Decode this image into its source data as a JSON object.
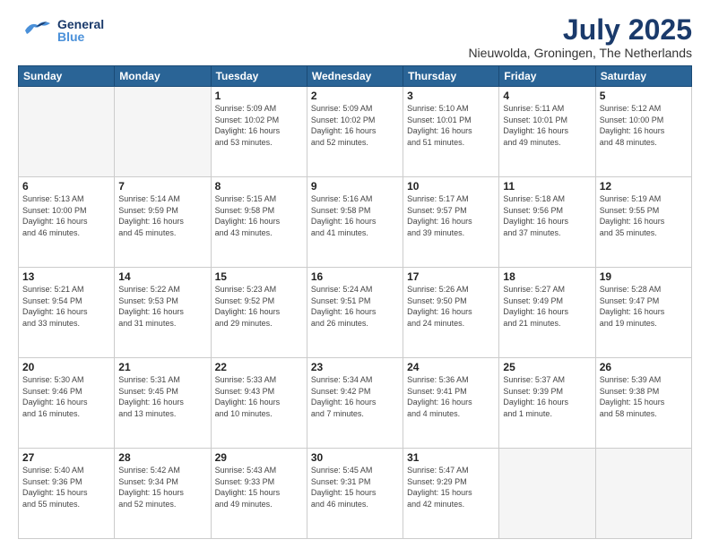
{
  "header": {
    "logo_general": "General",
    "logo_blue": "Blue",
    "month": "July 2025",
    "location": "Nieuwolda, Groningen, The Netherlands"
  },
  "days_of_week": [
    "Sunday",
    "Monday",
    "Tuesday",
    "Wednesday",
    "Thursday",
    "Friday",
    "Saturday"
  ],
  "weeks": [
    [
      {
        "day": "",
        "info": ""
      },
      {
        "day": "",
        "info": ""
      },
      {
        "day": "1",
        "info": "Sunrise: 5:09 AM\nSunset: 10:02 PM\nDaylight: 16 hours\nand 53 minutes."
      },
      {
        "day": "2",
        "info": "Sunrise: 5:09 AM\nSunset: 10:02 PM\nDaylight: 16 hours\nand 52 minutes."
      },
      {
        "day": "3",
        "info": "Sunrise: 5:10 AM\nSunset: 10:01 PM\nDaylight: 16 hours\nand 51 minutes."
      },
      {
        "day": "4",
        "info": "Sunrise: 5:11 AM\nSunset: 10:01 PM\nDaylight: 16 hours\nand 49 minutes."
      },
      {
        "day": "5",
        "info": "Sunrise: 5:12 AM\nSunset: 10:00 PM\nDaylight: 16 hours\nand 48 minutes."
      }
    ],
    [
      {
        "day": "6",
        "info": "Sunrise: 5:13 AM\nSunset: 10:00 PM\nDaylight: 16 hours\nand 46 minutes."
      },
      {
        "day": "7",
        "info": "Sunrise: 5:14 AM\nSunset: 9:59 PM\nDaylight: 16 hours\nand 45 minutes."
      },
      {
        "day": "8",
        "info": "Sunrise: 5:15 AM\nSunset: 9:58 PM\nDaylight: 16 hours\nand 43 minutes."
      },
      {
        "day": "9",
        "info": "Sunrise: 5:16 AM\nSunset: 9:58 PM\nDaylight: 16 hours\nand 41 minutes."
      },
      {
        "day": "10",
        "info": "Sunrise: 5:17 AM\nSunset: 9:57 PM\nDaylight: 16 hours\nand 39 minutes."
      },
      {
        "day": "11",
        "info": "Sunrise: 5:18 AM\nSunset: 9:56 PM\nDaylight: 16 hours\nand 37 minutes."
      },
      {
        "day": "12",
        "info": "Sunrise: 5:19 AM\nSunset: 9:55 PM\nDaylight: 16 hours\nand 35 minutes."
      }
    ],
    [
      {
        "day": "13",
        "info": "Sunrise: 5:21 AM\nSunset: 9:54 PM\nDaylight: 16 hours\nand 33 minutes."
      },
      {
        "day": "14",
        "info": "Sunrise: 5:22 AM\nSunset: 9:53 PM\nDaylight: 16 hours\nand 31 minutes."
      },
      {
        "day": "15",
        "info": "Sunrise: 5:23 AM\nSunset: 9:52 PM\nDaylight: 16 hours\nand 29 minutes."
      },
      {
        "day": "16",
        "info": "Sunrise: 5:24 AM\nSunset: 9:51 PM\nDaylight: 16 hours\nand 26 minutes."
      },
      {
        "day": "17",
        "info": "Sunrise: 5:26 AM\nSunset: 9:50 PM\nDaylight: 16 hours\nand 24 minutes."
      },
      {
        "day": "18",
        "info": "Sunrise: 5:27 AM\nSunset: 9:49 PM\nDaylight: 16 hours\nand 21 minutes."
      },
      {
        "day": "19",
        "info": "Sunrise: 5:28 AM\nSunset: 9:47 PM\nDaylight: 16 hours\nand 19 minutes."
      }
    ],
    [
      {
        "day": "20",
        "info": "Sunrise: 5:30 AM\nSunset: 9:46 PM\nDaylight: 16 hours\nand 16 minutes."
      },
      {
        "day": "21",
        "info": "Sunrise: 5:31 AM\nSunset: 9:45 PM\nDaylight: 16 hours\nand 13 minutes."
      },
      {
        "day": "22",
        "info": "Sunrise: 5:33 AM\nSunset: 9:43 PM\nDaylight: 16 hours\nand 10 minutes."
      },
      {
        "day": "23",
        "info": "Sunrise: 5:34 AM\nSunset: 9:42 PM\nDaylight: 16 hours\nand 7 minutes."
      },
      {
        "day": "24",
        "info": "Sunrise: 5:36 AM\nSunset: 9:41 PM\nDaylight: 16 hours\nand 4 minutes."
      },
      {
        "day": "25",
        "info": "Sunrise: 5:37 AM\nSunset: 9:39 PM\nDaylight: 16 hours\nand 1 minute."
      },
      {
        "day": "26",
        "info": "Sunrise: 5:39 AM\nSunset: 9:38 PM\nDaylight: 15 hours\nand 58 minutes."
      }
    ],
    [
      {
        "day": "27",
        "info": "Sunrise: 5:40 AM\nSunset: 9:36 PM\nDaylight: 15 hours\nand 55 minutes."
      },
      {
        "day": "28",
        "info": "Sunrise: 5:42 AM\nSunset: 9:34 PM\nDaylight: 15 hours\nand 52 minutes."
      },
      {
        "day": "29",
        "info": "Sunrise: 5:43 AM\nSunset: 9:33 PM\nDaylight: 15 hours\nand 49 minutes."
      },
      {
        "day": "30",
        "info": "Sunrise: 5:45 AM\nSunset: 9:31 PM\nDaylight: 15 hours\nand 46 minutes."
      },
      {
        "day": "31",
        "info": "Sunrise: 5:47 AM\nSunset: 9:29 PM\nDaylight: 15 hours\nand 42 minutes."
      },
      {
        "day": "",
        "info": ""
      },
      {
        "day": "",
        "info": ""
      }
    ]
  ]
}
